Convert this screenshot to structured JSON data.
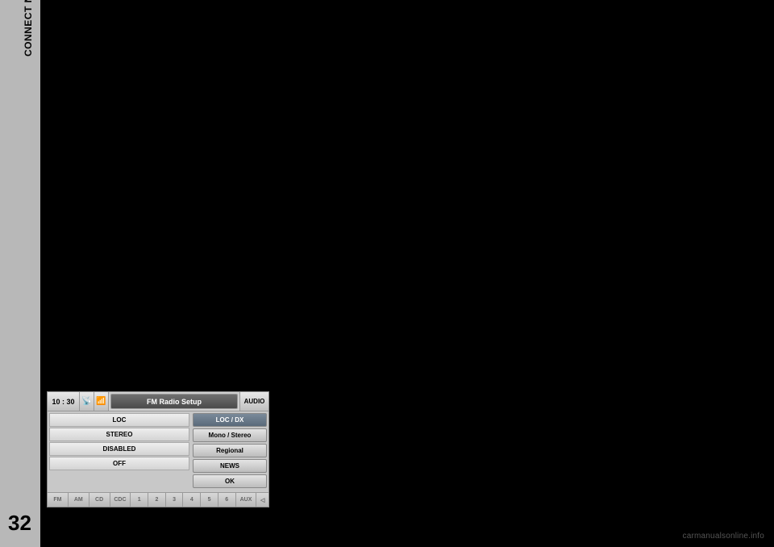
{
  "sidebar": {
    "vertical_label": "CONNECT Nav+",
    "page_number": "32"
  },
  "panel": {
    "header": {
      "time": "10 : 30",
      "satellite_icon": "📡",
      "phone_icon": "📶",
      "title": "FM Radio Setup",
      "right_label": "AUDIO"
    },
    "rows": [
      {
        "value": "LOC",
        "button": "LOC / DX",
        "selected": true
      },
      {
        "value": "STEREO",
        "button": "Mono / Stereo",
        "selected": false
      },
      {
        "value": "DISABLED",
        "button": "Regional",
        "selected": false
      },
      {
        "value": "OFF",
        "button": "NEWS",
        "selected": false
      }
    ],
    "ok_button": "OK",
    "footer": [
      "FM",
      "AM",
      "CD",
      "CDC",
      "1",
      "2",
      "3",
      "4",
      "5",
      "6",
      "AUX",
      "◁"
    ]
  },
  "watermark": "carmanualsonline.info"
}
